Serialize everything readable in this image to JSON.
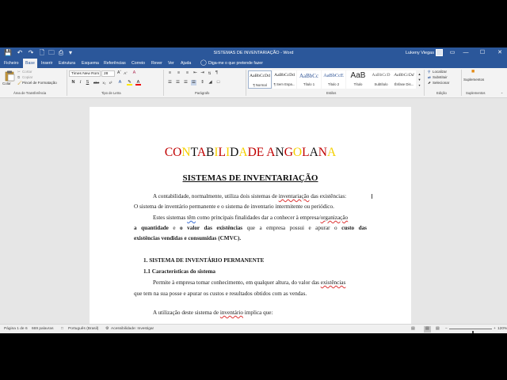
{
  "window": {
    "title": "SISTEMAS DE INVENTARIAÇÃO  -  Word",
    "user": "Lukeny Viegas",
    "controls": {
      "ribbon_display": "▭",
      "minimize": "—",
      "maximize": "☐",
      "close": "✕"
    }
  },
  "quick_access": {
    "save": "💾",
    "undo": "↶",
    "redo": "↷",
    "new": "🗋",
    "open": "🗀",
    "print_preview": "⎙",
    "customize": "▾"
  },
  "menu": {
    "tabs": [
      "Ficheiro",
      "Base",
      "Inserir",
      "Estrutura",
      "Esquema",
      "Referências",
      "Correio",
      "Rever",
      "Ver",
      "Ajuda"
    ],
    "active_tab": "Base",
    "tell_me": "Diga-me o que pretende fazer"
  },
  "ribbon": {
    "clipboard": {
      "paste": "Colar",
      "cut": "Cortar",
      "copy": "Copiar",
      "format_painter": "Pincel de Formatação",
      "label": "Área de Transferência"
    },
    "font": {
      "family": "Times New Rom",
      "size": "28",
      "label": "Tipo de Letra",
      "bold": "N",
      "italic": "I",
      "underline": "S",
      "clear": "A"
    },
    "paragraph": {
      "label": "Parágrafo"
    },
    "styles": {
      "label": "Estilos",
      "items": [
        {
          "preview": "AaBbCcDd",
          "name": "¶ Normal"
        },
        {
          "preview": "AaBbCcDd",
          "name": "¶ Sem Espa..."
        },
        {
          "preview": "AaBbCc",
          "name": "Título 1"
        },
        {
          "preview": "AaBbCcE",
          "name": "Título 2"
        },
        {
          "preview": "AaB",
          "name": "Título"
        },
        {
          "preview": "AaBbCcD",
          "name": "Subtítulo"
        },
        {
          "preview": "AaBbCcDd",
          "name": "Ênfase Dis..."
        }
      ]
    },
    "editing": {
      "find": "Localizar",
      "replace": "Substituir",
      "select": "Selecionar",
      "label": "Edição"
    },
    "addins": {
      "button": "Suplementos",
      "label": "Suplementos"
    }
  },
  "document": {
    "title_letters": [
      {
        "ch": "C",
        "color": "#c00000"
      },
      {
        "ch": "O",
        "color": "#c00000"
      },
      {
        "ch": "N",
        "color": "#f5d000"
      },
      {
        "ch": "T",
        "color": "#111111"
      },
      {
        "ch": "A",
        "color": "#c00000"
      },
      {
        "ch": "B",
        "color": "#111111"
      },
      {
        "ch": "I",
        "color": "#f5d000"
      },
      {
        "ch": "L",
        "color": "#c00000"
      },
      {
        "ch": "I",
        "color": "#f5d000"
      },
      {
        "ch": "D",
        "color": "#111111"
      },
      {
        "ch": "A",
        "color": "#f5d000"
      },
      {
        "ch": "D",
        "color": "#c00000"
      },
      {
        "ch": "E",
        "color": "#c00000"
      },
      {
        "ch": " ",
        "color": "#111111"
      },
      {
        "ch": "A",
        "color": "#c00000"
      },
      {
        "ch": "N",
        "color": "#111111"
      },
      {
        "ch": "G",
        "color": "#c00000"
      },
      {
        "ch": "O",
        "color": "#f5d000"
      },
      {
        "ch": "L",
        "color": "#c00000"
      },
      {
        "ch": "A",
        "color": "#111111"
      },
      {
        "ch": "N",
        "color": "#c00000"
      },
      {
        "ch": "A",
        "color": "#f5d000"
      }
    ],
    "subtitle": "SISTEMAS DE INVENTARIAÇÃO",
    "p1_l1_a": "A contabilidade, normalmente, utiliza dois sistemas de ",
    "p1_l1_b": "inventariação",
    "p1_l1_c": " das existências:",
    "p1_l2": "O sistema de inventário permanente e o sistema de inventario intermitente ou periódico.",
    "p2_l1_a": "Estes sistemas ",
    "p2_l1_b": "têm",
    "p2_l1_c": " como principais finalidades dar a conhecer à empresa/",
    "p2_l1_d": "organização",
    "p2_l2_a": "a quantidade",
    "p2_l2_b": " e ",
    "p2_l2_c": "o valor das existências",
    "p2_l2_d": " que a empresa possui e apurar o ",
    "p2_l2_e": "custo das",
    "p2_l3": "existências vendidas e consumidas (CMVC).",
    "h1": "1.   SISTEMA DE INVENTÁRIO PERMANENTE",
    "h2": "1.1 Características do sistema",
    "p3_l1_a": "Permite à empresa tomar conhecimento, em qualquer altura, do valor das ",
    "p3_l1_b": "existências",
    "p3_l2": "que tem na sua posse e apurar os custos e resultados obtidos com as vendas.",
    "p4_a": "A utilização deste sistema de ",
    "p4_b": "inventário",
    "p4_c": " implica que:"
  },
  "status": {
    "page": "Página 1 de 6",
    "words": "669 palavras",
    "language": "Português (Brasil)",
    "accessibility": "Acessibilidade: Investigar",
    "zoom": "120%",
    "zoom_fraction": 0.55
  }
}
